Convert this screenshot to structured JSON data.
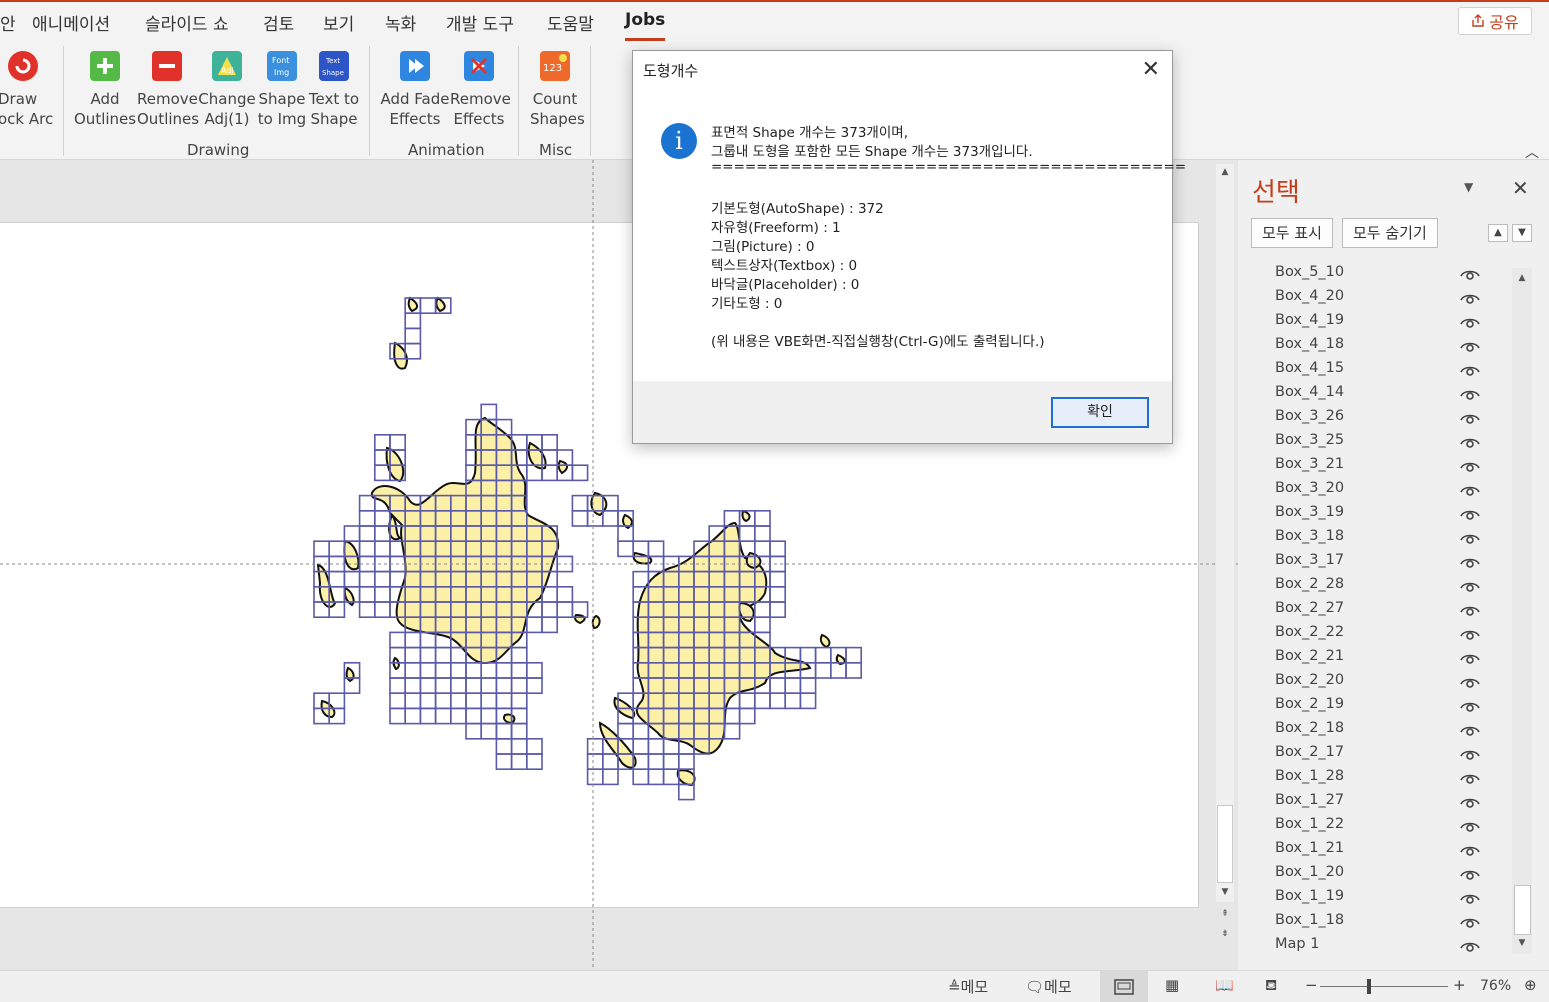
{
  "tabs": [
    "안",
    "애니메이션",
    "슬라이드 쇼",
    "검토",
    "보기",
    "녹화",
    "개발 도구",
    "도움말",
    "Jobs"
  ],
  "active_tab": "Jobs",
  "share_label": "공유",
  "ribbon": {
    "buttons": [
      {
        "label": "Draw\nock Arc",
        "icon": "draw-arc-icon",
        "color": "#e0322b"
      },
      {
        "label": "Add\nOutlines",
        "icon": "add-outlines-icon",
        "color": "#54b947"
      },
      {
        "label": "Remove\nOutlines",
        "icon": "remove-outlines-icon",
        "color": "#e0322b"
      },
      {
        "label": "Change\nAdj(1)",
        "icon": "change-adj-icon",
        "color": "#3fb39a"
      },
      {
        "label": "Shape\nto Img",
        "icon": "shape-to-img-icon",
        "color": "#3a8fde"
      },
      {
        "label": "Text to\nShape",
        "icon": "text-to-shape-icon",
        "color": "#2c55c8"
      },
      {
        "label": "Add Fade\nEffects",
        "icon": "add-fade-effects-icon",
        "color": "#2f86e0"
      },
      {
        "label": "Remove\nEffects",
        "icon": "remove-effects-icon",
        "color": "#2f86e0"
      },
      {
        "label": "Count\nShapes",
        "icon": "count-shapes-icon",
        "color": "#ef6a2a"
      }
    ],
    "groups": [
      "Drawing",
      "Animation",
      "Misc"
    ]
  },
  "dialog": {
    "title": "도형개수",
    "lines": [
      "표면적 Shape 개수는 373개이며,",
      "그룹내 도형을 포함한 모든 Shape 개수는 373개입니다.",
      "==========================================",
      "",
      "기본도형(AutoShape) : 372",
      "자유형(Freeform) : 1",
      "그림(Picture) : 0",
      "텍스트상자(Textbox) : 0",
      "바닥글(Placeholder) : 0",
      "기타도형 : 0",
      "",
      "(위 내용은 VBE화면-직접실행창(Ctrl-G)에도 출력됩니다.)"
    ],
    "ok_label": "확인"
  },
  "pane": {
    "title": "선택",
    "show_all": "모두 표시",
    "hide_all": "모두 숨기기",
    "items": [
      "Box_5_10",
      "Box_4_20",
      "Box_4_19",
      "Box_4_18",
      "Box_4_15",
      "Box_4_14",
      "Box_3_26",
      "Box_3_25",
      "Box_3_21",
      "Box_3_20",
      "Box_3_19",
      "Box_3_18",
      "Box_3_17",
      "Box_2_28",
      "Box_2_27",
      "Box_2_22",
      "Box_2_21",
      "Box_2_20",
      "Box_2_19",
      "Box_2_18",
      "Box_2_17",
      "Box_1_28",
      "Box_1_27",
      "Box_1_22",
      "Box_1_21",
      "Box_1_20",
      "Box_1_19",
      "Box_1_18",
      "Map 1"
    ]
  },
  "status": {
    "notes1": "메모",
    "notes2": "메모",
    "zoom_minus": "−",
    "zoom_plus": "+",
    "zoom": "76%"
  },
  "colors": {
    "accent": "#c43e1c",
    "grid": "#5a5aa8",
    "land": "#fbf0a6"
  }
}
